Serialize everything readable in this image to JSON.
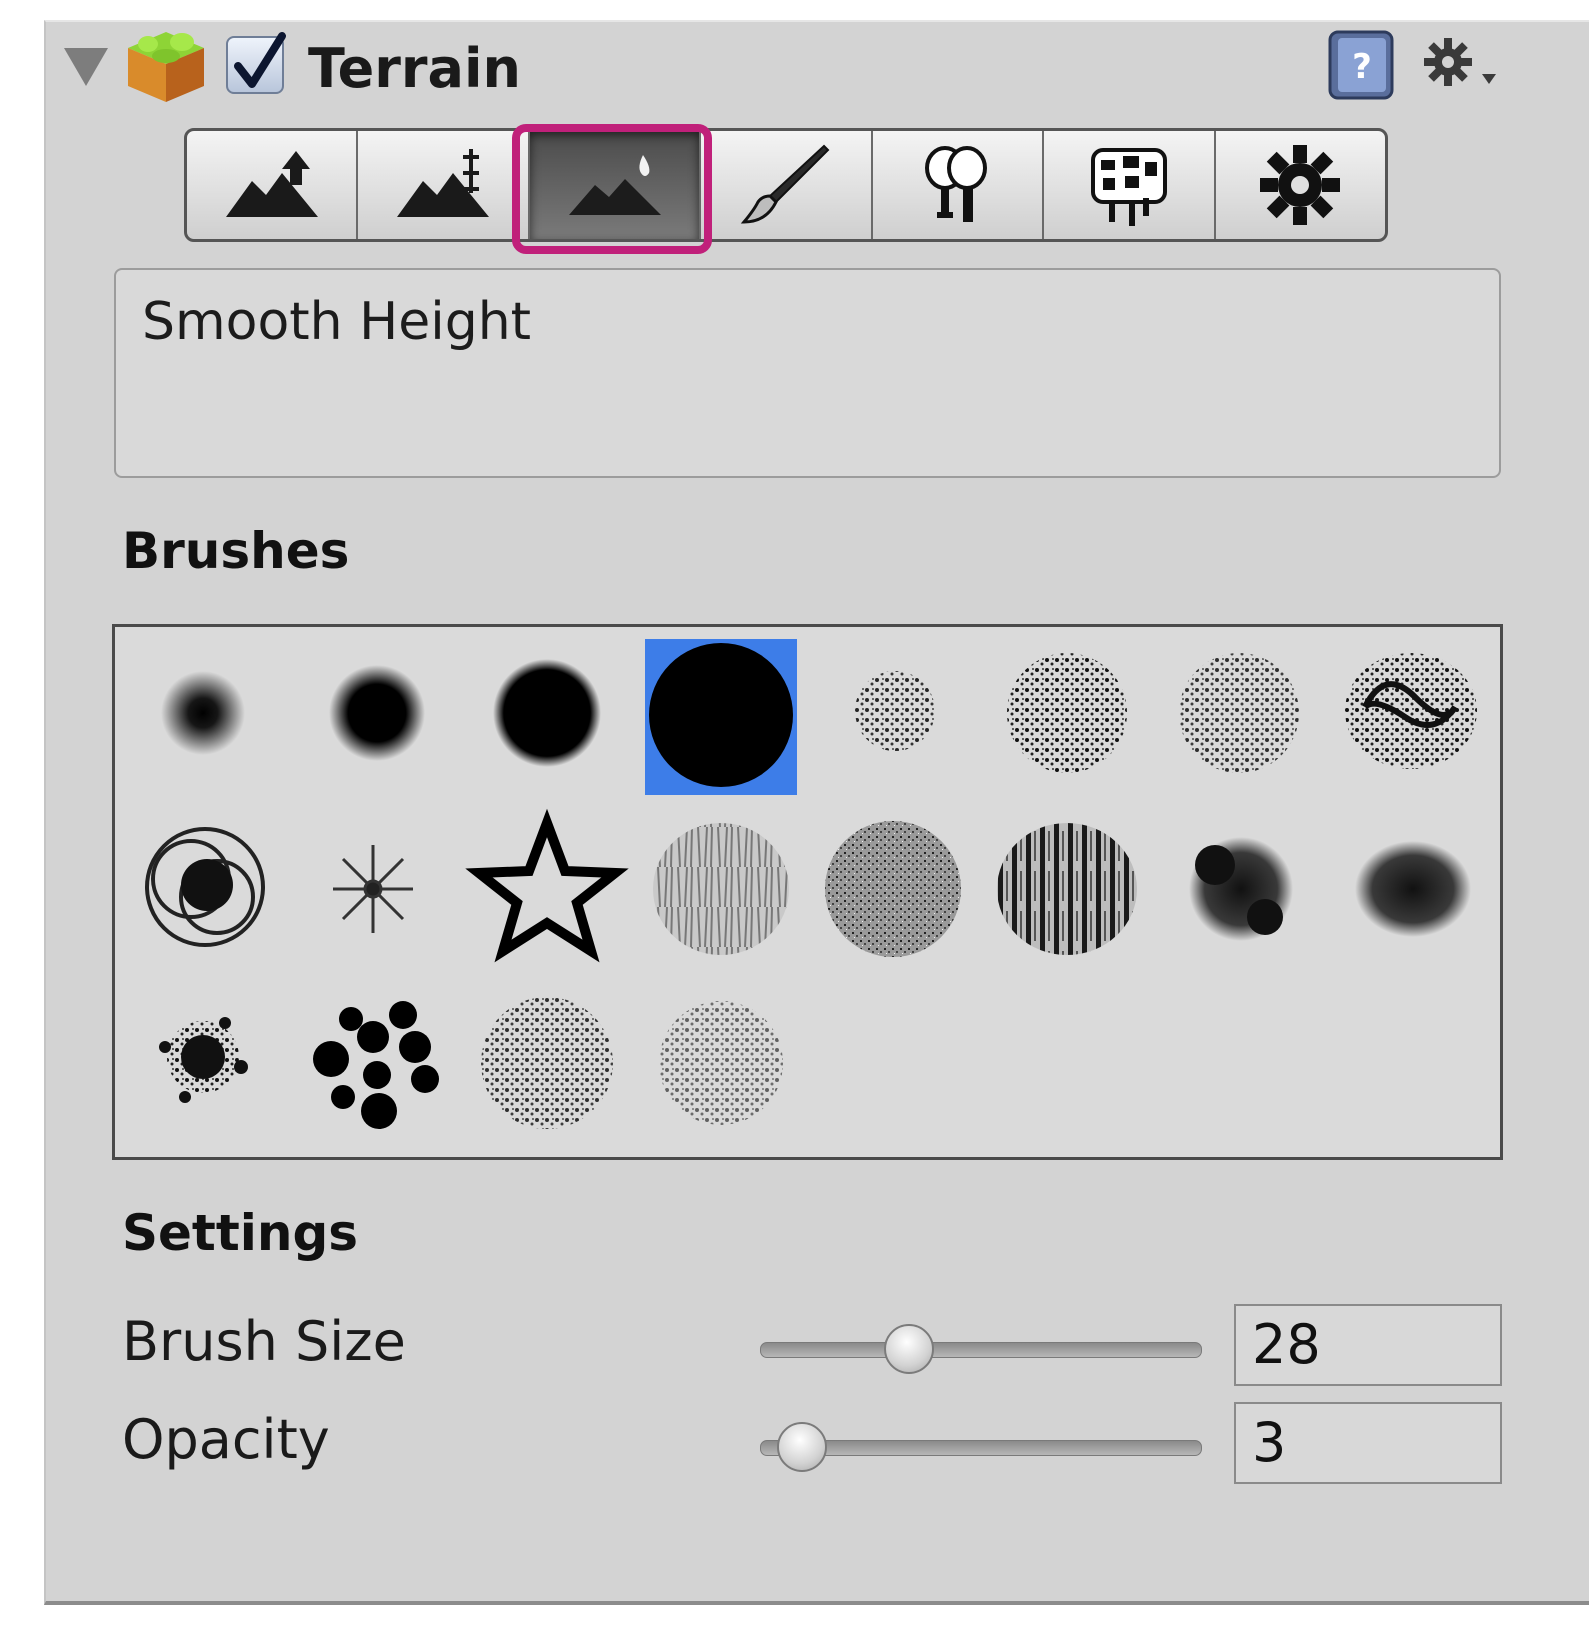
{
  "component": {
    "title": "Terrain",
    "enabled": true
  },
  "toolbar": {
    "tools": [
      {
        "name": "raise-lower-terrain-icon",
        "selected": false
      },
      {
        "name": "paint-height-icon",
        "selected": false
      },
      {
        "name": "smooth-height-icon",
        "selected": true
      },
      {
        "name": "paint-texture-icon",
        "selected": false
      },
      {
        "name": "place-trees-icon",
        "selected": false
      },
      {
        "name": "paint-details-icon",
        "selected": false
      },
      {
        "name": "terrain-settings-icon",
        "selected": false
      }
    ],
    "highlight_color": "#c0207a"
  },
  "description": {
    "text": "Smooth Height"
  },
  "brushes": {
    "label": "Brushes",
    "selected_index": 3,
    "selection_color": "#3d7de8",
    "items": [
      "soft-round-small",
      "soft-round-medium",
      "hard-round",
      "hard-round-large",
      "speckle-small",
      "speckle-medium",
      "speckle-large",
      "scribble-texture",
      "swirl-circles",
      "starburst",
      "star-outline",
      "bark-texture",
      "noise-texture",
      "streak-texture",
      "splat-dark",
      "splat-soft",
      "splatter-dots",
      "dots-cluster",
      "leaf-scatter",
      "light-scatter"
    ]
  },
  "settings": {
    "label": "Settings",
    "brush_size": {
      "label": "Brush Size",
      "value": "28",
      "slider_fraction": 0.28
    },
    "opacity": {
      "label": "Opacity",
      "value": "3",
      "slider_fraction": 0.03
    }
  }
}
